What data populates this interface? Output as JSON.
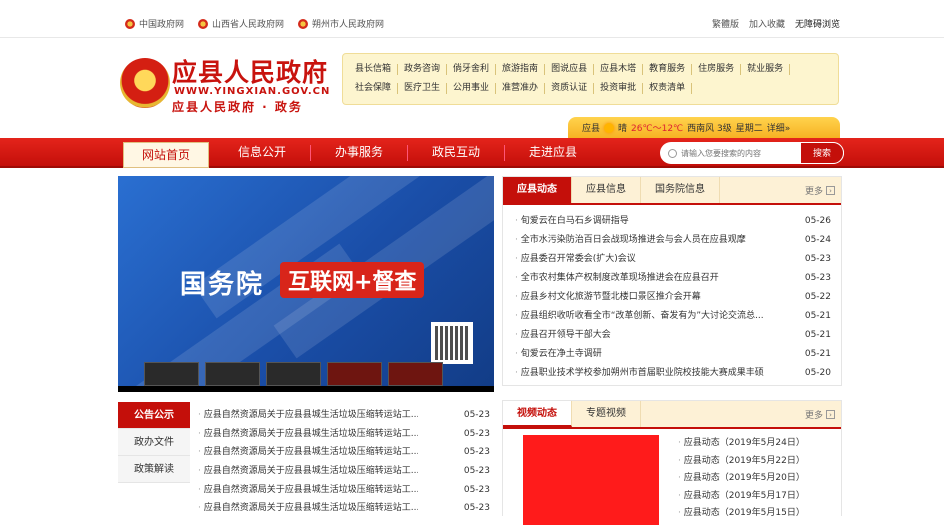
{
  "top": {
    "links": [
      "中国政府网",
      "山西省人民政府网",
      "朔州市人民政府网"
    ],
    "right": [
      "繁體版",
      "加入收藏",
      "无障碍浏览"
    ]
  },
  "header": {
    "title": "应县人民政府",
    "url": "WWW.YINGXIAN.GOV.CN",
    "subtitle": "应县人民政府 · 政务",
    "quicklinks_row1": [
      "县长信箱",
      "政务咨询",
      "倘牙舍利",
      "旅游指南",
      "图说应县",
      "应县木塔",
      "教育服务",
      "住房服务",
      "就业服务"
    ],
    "quicklinks_row2": [
      "社会保障",
      "医疗卫生",
      "公用事业",
      "准营准办",
      "资质认证",
      "投资审批",
      "权责清单"
    ]
  },
  "weather": {
    "city": "应县",
    "condition": "晴",
    "temp": "26℃～12℃",
    "wind": "西南风 3级",
    "weekday": "星期二",
    "detail": "详细»"
  },
  "nav": {
    "items": [
      "网站首页",
      "信息公开",
      "办事服务",
      "政民互动",
      "走进应县"
    ],
    "search_placeholder": "请输入您要搜索的内容",
    "search_button": "搜索"
  },
  "banner": {
    "title": "国务院",
    "tag": "互联网+督查"
  },
  "news": {
    "tabs": [
      "应县动态",
      "应县信息",
      "国务院信息"
    ],
    "more": "更多",
    "items": [
      {
        "title": "旬爱云在白马石乡调研指导",
        "date": "05-26"
      },
      {
        "title": "全市水污染防治百日会战现场推进会与会人员在应县观摩",
        "date": "05-24"
      },
      {
        "title": "应县委召开常委会(扩大)会议",
        "date": "05-23"
      },
      {
        "title": "全市农村集体产权制度改革现场推进会在应县召开",
        "date": "05-23"
      },
      {
        "title": "应县乡村文化旅游节暨北楼口景区推介会开幕",
        "date": "05-22"
      },
      {
        "title": "应县组织收听收看全市“改革创新、奋发有为”大讨论交流总...",
        "date": "05-21"
      },
      {
        "title": "应县召开领导干部大会",
        "date": "05-21"
      },
      {
        "title": "旬爱云在净土寺调研",
        "date": "05-21"
      },
      {
        "title": "应县职业技术学校参加朔州市首届职业院校技能大赛成果丰硕",
        "date": "05-20"
      }
    ]
  },
  "notice": {
    "tabs": [
      "公告公示",
      "政办文件",
      "政策解读"
    ],
    "items": [
      {
        "title": "应县自然资源局关于应县县城生活垃圾压缩转运站工...",
        "date": "05-23"
      },
      {
        "title": "应县自然资源局关于应县县城生活垃圾压缩转运站工...",
        "date": "05-23"
      },
      {
        "title": "应县自然资源局关于应县县城生活垃圾压缩转运站工...",
        "date": "05-23"
      },
      {
        "title": "应县自然资源局关于应县县城生活垃圾压缩转运站工...",
        "date": "05-23"
      },
      {
        "title": "应县自然资源局关于应县县城生活垃圾压缩转运站工...",
        "date": "05-23"
      },
      {
        "title": "应县自然资源局关于应县县城生活垃圾压缩转运站工...",
        "date": "05-23"
      }
    ]
  },
  "video": {
    "tabs": [
      "视频动态",
      "专题视频"
    ],
    "more": "更多",
    "items": [
      "应县动态（2019年5月24日）",
      "应县动态（2019年5月22日）",
      "应县动态（2019年5月20日）",
      "应县动态（2019年5月17日）",
      "应县动态（2019年5月15日）"
    ]
  }
}
